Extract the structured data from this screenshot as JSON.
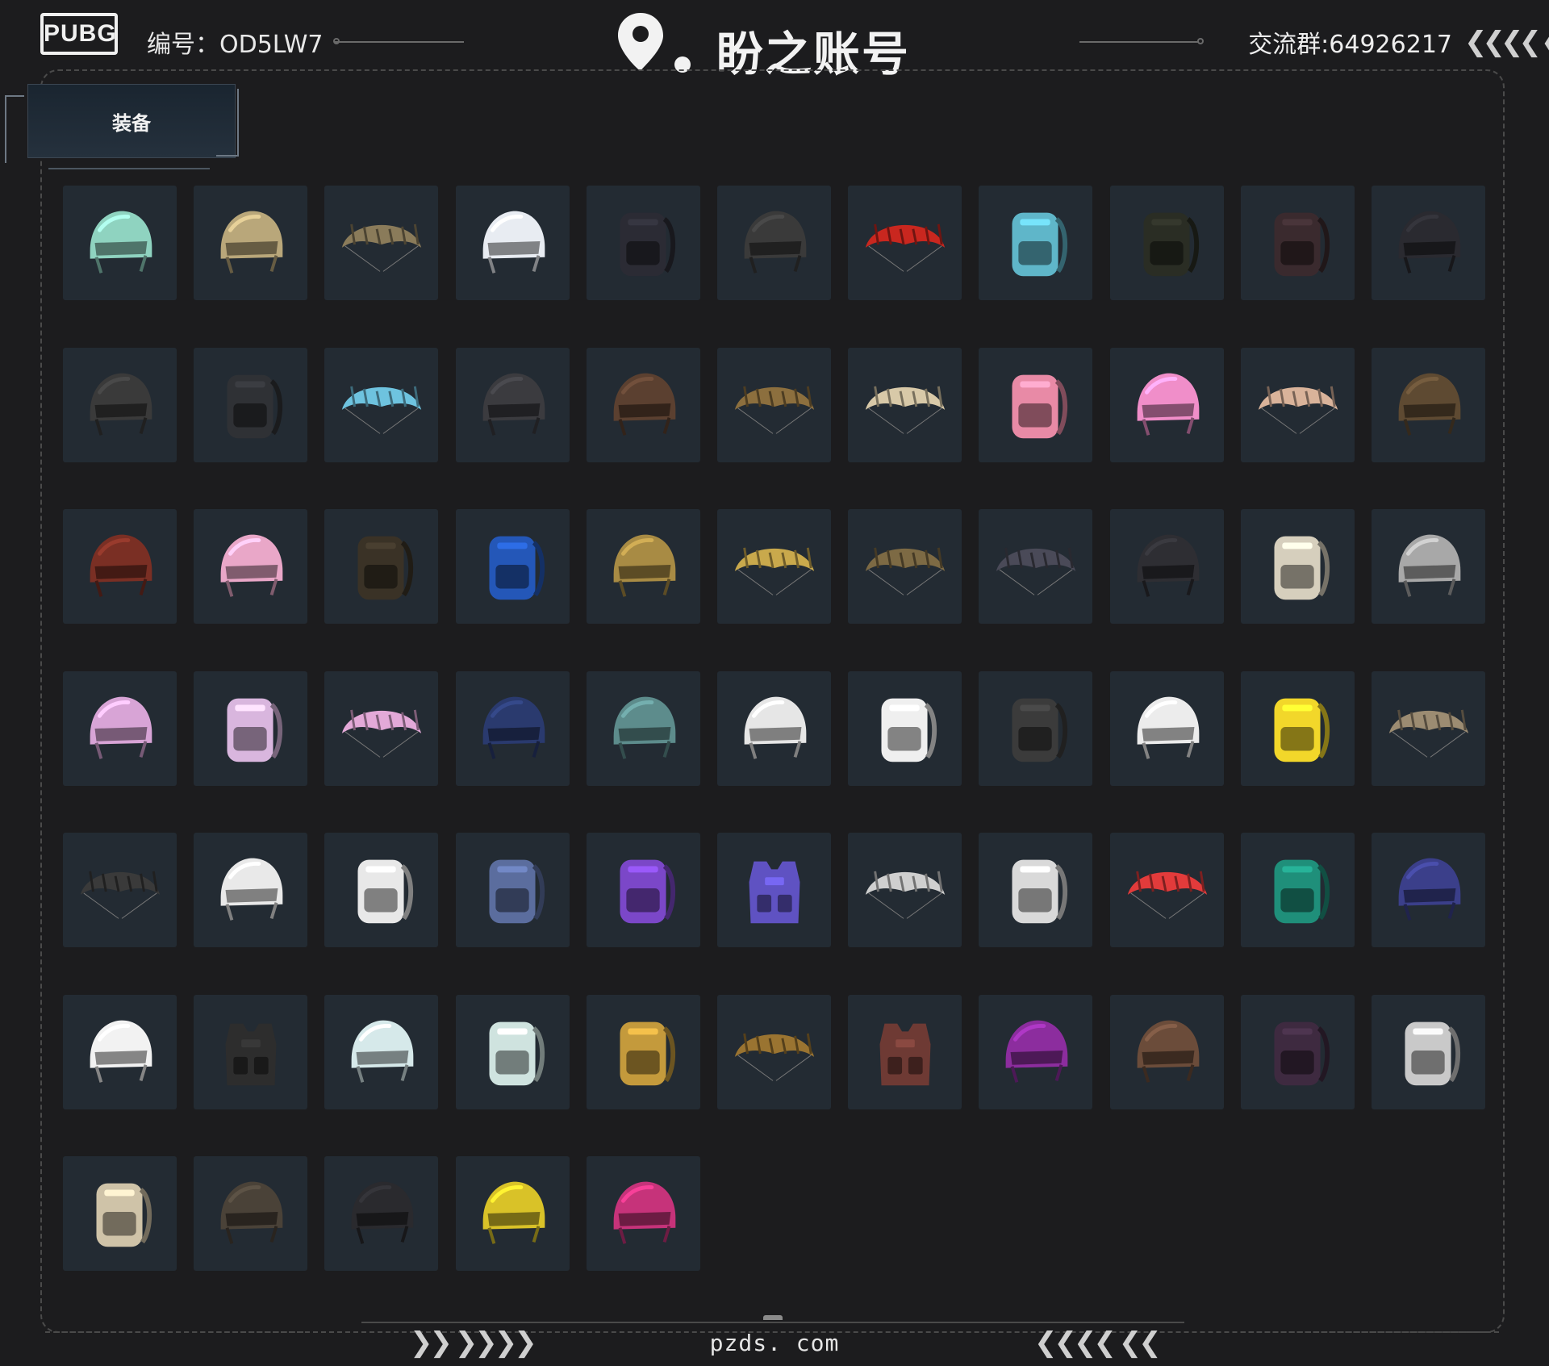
{
  "header": {
    "logo_text": "PUBG",
    "serial_label": "编号：",
    "serial_value": "OD5LW7",
    "brand_name": "盼之账号",
    "group_label": "交流群:",
    "group_value": "64926217",
    "chevrons_right": "❮❮❮❮ ❮"
  },
  "tab": {
    "label": "装备"
  },
  "items": [
    {
      "type": "helmet",
      "color": "#8fd3c0"
    },
    {
      "type": "helmet",
      "color": "#b9a77a"
    },
    {
      "type": "parachute",
      "color": "#8a7b5a"
    },
    {
      "type": "helmet",
      "color": "#e8ecf2"
    },
    {
      "type": "backpack",
      "color": "#2b2b34"
    },
    {
      "type": "helmet",
      "color": "#3a3a3a"
    },
    {
      "type": "parachute",
      "color": "#c9271f"
    },
    {
      "type": "backpack",
      "color": "#5fb6c9"
    },
    {
      "type": "backpack",
      "color": "#2a2d24"
    },
    {
      "type": "backpack",
      "color": "#3a2a2e"
    },
    {
      "type": "helmet",
      "color": "#2a2a30"
    },
    {
      "type": "helmet",
      "color": "#3a3a3a"
    },
    {
      "type": "backpack",
      "color": "#2f3135"
    },
    {
      "type": "parachute",
      "color": "#6ec3df"
    },
    {
      "type": "helmet",
      "color": "#3b3b3f"
    },
    {
      "type": "helmet",
      "color": "#5b4030"
    },
    {
      "type": "parachute",
      "color": "#8c6f3e"
    },
    {
      "type": "parachute",
      "color": "#d8c9a8"
    },
    {
      "type": "backpack",
      "color": "#e88aa6"
    },
    {
      "type": "helmet",
      "color": "#f08ec9"
    },
    {
      "type": "parachute",
      "color": "#d9b39a"
    },
    {
      "type": "helmet",
      "color": "#5e4a32"
    },
    {
      "type": "helmet",
      "color": "#7a2f24"
    },
    {
      "type": "helmet",
      "color": "#e9a7c8"
    },
    {
      "type": "backpack",
      "color": "#3a3226"
    },
    {
      "type": "backpack",
      "color": "#2457b8"
    },
    {
      "type": "helmet",
      "color": "#a88b44"
    },
    {
      "type": "parachute",
      "color": "#c9a94c"
    },
    {
      "type": "parachute",
      "color": "#7d6a44"
    },
    {
      "type": "parachute",
      "color": "#4a4a58"
    },
    {
      "type": "helmet",
      "color": "#2e2e33"
    },
    {
      "type": "backpack",
      "color": "#d6cfbd"
    },
    {
      "type": "helmet",
      "color": "#a8a8a8"
    },
    {
      "type": "helmet",
      "color": "#d8a4d6"
    },
    {
      "type": "backpack",
      "color": "#d9b6de"
    },
    {
      "type": "parachute",
      "color": "#e3a9d8"
    },
    {
      "type": "helmet",
      "color": "#2a3a6e"
    },
    {
      "type": "helmet",
      "color": "#5d8c8c"
    },
    {
      "type": "helmet",
      "color": "#e6e6e6"
    },
    {
      "type": "backpack",
      "color": "#efefef"
    },
    {
      "type": "backpack",
      "color": "#3b3b3b"
    },
    {
      "type": "helmet",
      "color": "#ececec"
    },
    {
      "type": "backpack",
      "color": "#f2d72a"
    },
    {
      "type": "parachute",
      "color": "#9c8c72"
    },
    {
      "type": "parachute",
      "color": "#3a3a3a"
    },
    {
      "type": "helmet",
      "color": "#e9e9e9"
    },
    {
      "type": "backpack",
      "color": "#e8e8e8"
    },
    {
      "type": "backpack",
      "color": "#5b6d9e"
    },
    {
      "type": "backpack",
      "color": "#7b47c8"
    },
    {
      "type": "vest",
      "color": "#5f52c2"
    },
    {
      "type": "parachute",
      "color": "#cfcfcf"
    },
    {
      "type": "backpack",
      "color": "#d9d9d9"
    },
    {
      "type": "parachute",
      "color": "#e23b3b"
    },
    {
      "type": "backpack",
      "color": "#1f8f7a"
    },
    {
      "type": "helmet",
      "color": "#3b3f8a"
    },
    {
      "type": "helmet",
      "color": "#f2f2f2"
    },
    {
      "type": "vest",
      "color": "#2d2d2d"
    },
    {
      "type": "helmet",
      "color": "#d6e9ea"
    },
    {
      "type": "backpack",
      "color": "#cfe3df"
    },
    {
      "type": "backpack",
      "color": "#c49a3c"
    },
    {
      "type": "parachute",
      "color": "#9a7431"
    },
    {
      "type": "vest",
      "color": "#6e3a34"
    },
    {
      "type": "helmet",
      "color": "#8c2d9e"
    },
    {
      "type": "helmet",
      "color": "#6b4c3a"
    },
    {
      "type": "backpack",
      "color": "#3e2a40"
    },
    {
      "type": "backpack",
      "color": "#c9c9c9"
    },
    {
      "type": "backpack",
      "color": "#cfc3a8"
    },
    {
      "type": "helmet",
      "color": "#4a4238"
    },
    {
      "type": "helmet",
      "color": "#2a2a2e"
    },
    {
      "type": "helmet",
      "color": "#d9c228"
    },
    {
      "type": "helmet",
      "color": "#c6337a"
    }
  ],
  "footer": {
    "domain": "pzds. com",
    "chevrons_left": "❯❯ ❯❯❯❯",
    "chevrons_right": "❮❮❮❮ ❮❮"
  }
}
